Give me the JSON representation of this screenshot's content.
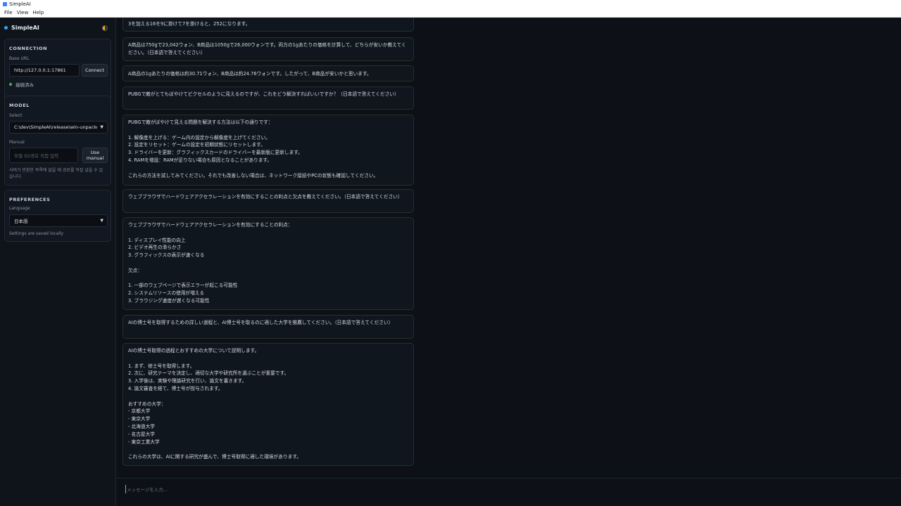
{
  "window": {
    "title": "SimpleAI"
  },
  "menu": [
    "File",
    "View",
    "Help"
  ],
  "sidebar": {
    "brand": "SimpleAI",
    "connection": {
      "heading": "CONNECTION",
      "base_url_label": "Base URL",
      "base_url_value": "http://127.0.0.1:17861",
      "connect_button": "Connect",
      "status": "接続済み"
    },
    "model": {
      "heading": "MODEL",
      "select_label": "Select",
      "select_value": "C:\\dev\\SimpleAI\\release\\win-unpacke",
      "manual_label": "Manual",
      "manual_placeholder": "모델 ID/경로 직접 입력",
      "use_manual_button": "Use manual",
      "hint": "서버가 반환한 목록에 없을 때 경로를 직접 넣을 수 있습니다."
    },
    "preferences": {
      "heading": "PREFERENCES",
      "language_label": "Language",
      "language_value": "日本語",
      "saved_note": "Settings are saved locally"
    }
  },
  "messages": [
    {
      "text": "3を加える16を9に掛けて7を掛けると、252になります。"
    },
    {
      "text": "A商品は750gで23,042ウォン、B商品は1050gで26,000ウォンです。両方の1gあたりの価格を計算して、どちらが安いか教えてください。（日本語で答えてください）"
    },
    {
      "text": "A商品の1gあたりの価格は約30.71ウォン、B商品は約24.76ウォンです。したがって、B商品が安いかと思います。"
    },
    {
      "text": "PUBGで敵がとてもぼやけてピクセルのように見えるのですが、これをどう解決すればいいですか？（日本語で答えてください）"
    },
    {
      "text": "PUBGで敵がぼやけて見える問題を解決する方法は以下の通りです：\n\n1. 解像度を上げる：ゲーム内の設定から解像度を上げてください。\n2. 設定をリセット：ゲームの設定を初期状態にリセットします。\n3. ドライバーを更新：グラフィックスカードのドライバーを最新版に更新します。\n4. RAMを増設：RAMが足りない場合も原因となることがあります。\n\nこれらの方法を試してみてください。それでも改善しない場合は、ネットワーク接続やPCの状態も確認してください。"
    },
    {
      "text": "ウェブブラウザでハードウェアアクセラレーションを有効にすることの利点と欠点を教えてください。（日本語で答えてください）"
    },
    {
      "text": "ウェブブラウザでハードウェアアクセラレーションを有効にすることの利点：\n\n1. ディスプレイ性能の向上\n2. ビデオ再生の滑らかさ\n3. グラフィックスの表示が速くなる\n\n欠点：\n\n1. 一部のウェブページで表示エラーが起こる可能性\n2. システムリソースの使用が増える\n3. ブラウジング速度が遅くなる可能性"
    },
    {
      "text": "AIの博士号を取得するための詳しい過程と、AI博士号を取るのに適した大学を推薦してください。（日本語で答えてください）"
    },
    {
      "text": "AIの博士号取得の過程とおすすめの大学について説明します。\n\n1. まず、修士号を取得します。\n2. 次に、研究テーマを決定し、適切な大学や研究所を選ぶことが重要です。\n3. 入学後は、実験や理論研究を行い、論文を書きます。\n4. 論文審査を経て、博士号が授与されます。\n\nおすすめの大学：\n- 京都大学\n- 東京大学\n- 北海道大学\n- 名古屋大学\n- 東京工業大学\n\nこれらの大学は、AIに関する研究が盛んで、博士号取得に適した環境があります。"
    }
  ],
  "composer": {
    "placeholder": "メッセージを入力..."
  }
}
